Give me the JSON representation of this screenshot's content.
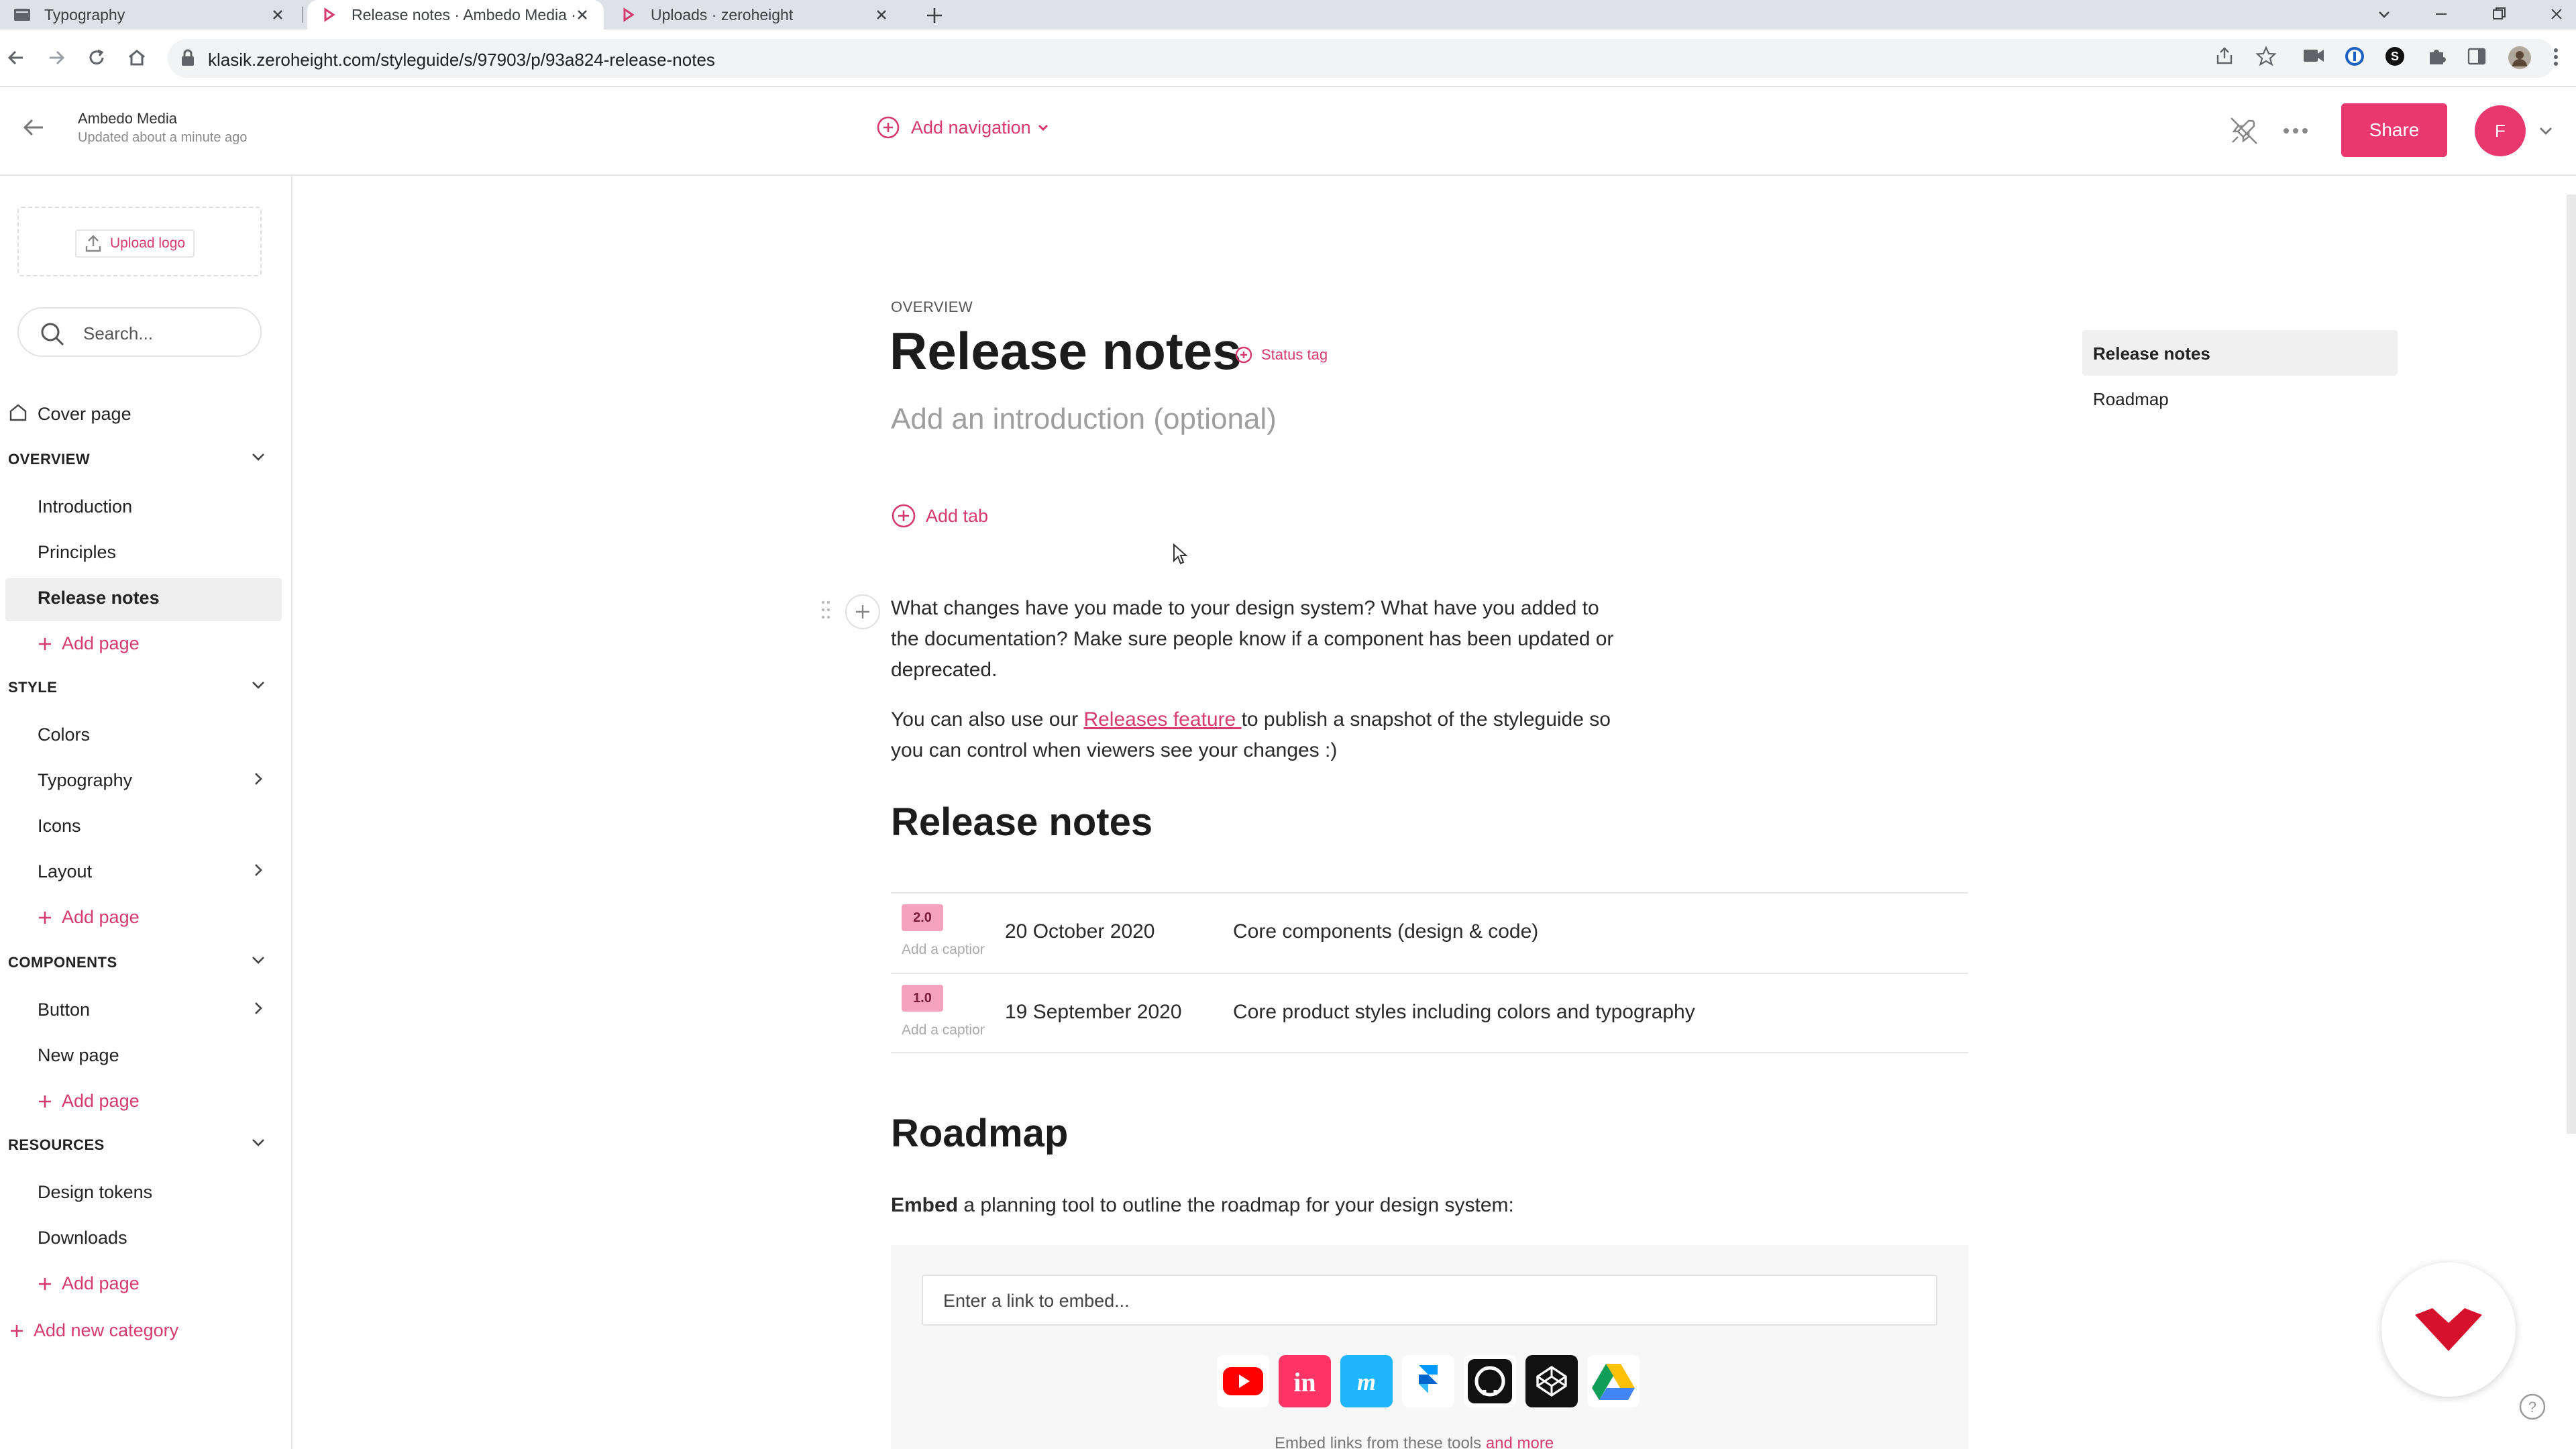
{
  "browser": {
    "tabs": [
      {
        "title": "Typography"
      },
      {
        "title": "Release notes · Ambedo Media ·"
      },
      {
        "title": "Uploads · zeroheight"
      }
    ],
    "url": "klasik.zeroheight.com/styleguide/s/97903/p/93a824-release-notes"
  },
  "header": {
    "org_name": "Ambedo Media",
    "updated": "Updated about a minute ago",
    "add_navigation": "Add navigation",
    "share": "Share",
    "avatar_initial": "F"
  },
  "sidebar": {
    "upload_logo": "Upload logo",
    "search_placeholder": "Search...",
    "cover_page": "Cover page",
    "add_page": "Add page",
    "add_new_category": "Add new category",
    "categories": [
      {
        "name": "OVERVIEW",
        "items": [
          "Introduction",
          "Principles",
          "Release notes"
        ]
      },
      {
        "name": "STYLE",
        "items": [
          "Colors",
          "Typography",
          "Icons",
          "Layout"
        ]
      },
      {
        "name": "COMPONENTS",
        "items": [
          "Button",
          "New page"
        ]
      },
      {
        "name": "RESOURCES",
        "items": [
          "Design tokens",
          "Downloads"
        ]
      }
    ]
  },
  "page": {
    "overline": "OVERVIEW",
    "title": "Release notes",
    "status_tag": "Status tag",
    "intro_placeholder": "Add an introduction (optional)",
    "add_tab": "Add tab",
    "para1": "What changes have you made to your design system? What have you added to the documentation? Make sure people know if a component has been updated or deprecated.",
    "para2_before": "You can also use our ",
    "para2_link": "Releases feature ",
    "para2_after": "to publish a snapshot of the styleguide so you can control when viewers see your changes :)",
    "release_heading": "Release notes",
    "releases": [
      {
        "version": "2.0",
        "caption": "Add a caption",
        "date": "20 October 2020",
        "description": "Core components (design & code)"
      },
      {
        "version": "1.0",
        "caption": "Add a caption",
        "date": "19 September 2020",
        "description": "Core product styles including colors and typography"
      }
    ],
    "roadmap_heading": "Roadmap",
    "embed_bold": "Embed",
    "embed_rest": " a planning tool to outline the roadmap for your design system:",
    "embed_placeholder": "Enter a link to embed...",
    "embed_foot": "Embed links from these tools",
    "embed_foot_more": "and more",
    "embed_tools": [
      "youtube-icon",
      "invision-icon",
      "marvel-icon",
      "framer-icon",
      "github-icon",
      "codepen-icon",
      "google-drive-icon"
    ]
  },
  "toc": {
    "items": [
      "Release notes",
      "Roadmap"
    ]
  },
  "colors": {
    "accent": "#e8386d",
    "badge": "#f4a2be"
  }
}
